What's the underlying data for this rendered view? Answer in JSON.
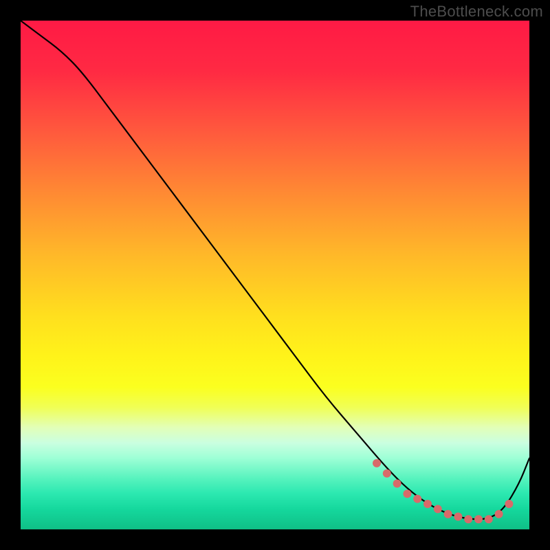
{
  "watermark": "TheBottleneck.com",
  "colors": {
    "page_bg": "#000000",
    "curve": "#000000",
    "dots": "#d86a6a",
    "watermark": "#4d4d4d"
  },
  "chart_data": {
    "type": "line",
    "title": "",
    "xlabel": "",
    "ylabel": "",
    "xlim": [
      0,
      100
    ],
    "ylim": [
      0,
      100
    ],
    "grid": false,
    "legend": false,
    "series": [
      {
        "name": "curve",
        "x": [
          0,
          4,
          8,
          12,
          18,
          24,
          30,
          36,
          42,
          48,
          54,
          60,
          66,
          72,
          76,
          80,
          84,
          88,
          92,
          95,
          98,
          100
        ],
        "y": [
          100,
          97,
          94,
          90,
          82,
          74,
          66,
          58,
          50,
          42,
          34,
          26,
          19,
          12,
          8,
          5,
          3,
          2,
          2,
          4,
          9,
          14
        ]
      }
    ],
    "trough_dots": {
      "x": [
        70,
        72,
        74,
        76,
        78,
        80,
        82,
        84,
        86,
        88,
        90,
        92,
        94,
        96
      ],
      "y": [
        13,
        11,
        9,
        7,
        6,
        5,
        4,
        3,
        2.5,
        2,
        2,
        2,
        3,
        5
      ]
    }
  }
}
